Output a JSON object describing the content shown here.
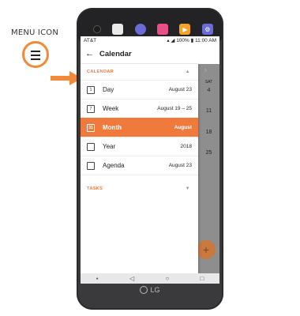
{
  "callout": {
    "label": "MENU ICON",
    "icon": "hamburger-menu-icon",
    "accent": "#f08a3a"
  },
  "status_bar": {
    "carrier": "AT&T",
    "battery": "100%",
    "time": "11:00 AM"
  },
  "app_bar": {
    "title": "Calendar"
  },
  "drawer": {
    "section_calendar": "CALENDAR",
    "items": [
      {
        "label": "Day",
        "date": "August 23",
        "icon_text": "1"
      },
      {
        "label": "Week",
        "date": "August 19 – 25",
        "icon_text": "7"
      },
      {
        "label": "Month",
        "date": "August",
        "icon_text": "31"
      },
      {
        "label": "Year",
        "date": "2018",
        "icon_text": ""
      },
      {
        "label": "Agenda",
        "date": "August 23",
        "icon_text": ""
      }
    ],
    "section_tasks": "TASKS"
  },
  "background_calendar": {
    "header": "SAT",
    "days": [
      "4",
      "11",
      "18",
      "25"
    ]
  },
  "brand": "LG",
  "colors": {
    "accent": "#f07a3c",
    "active_bg": "#f07a3c"
  }
}
